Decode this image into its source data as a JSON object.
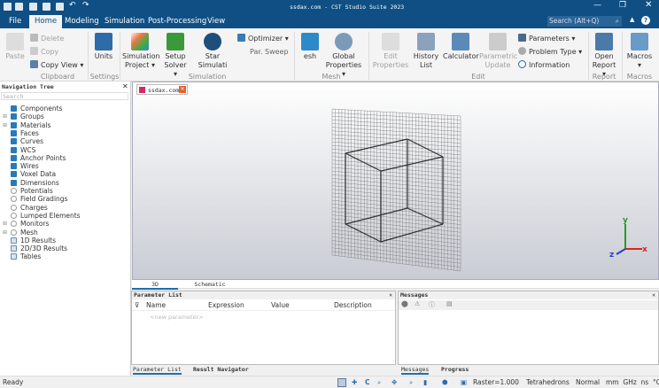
{
  "window": {
    "title": "ssdax.com - CST Studio Suite 2023",
    "search_placeholder": "Search (Alt+Q)"
  },
  "menu_tabs": [
    "File",
    "Home",
    "Modeling",
    "Simulation",
    "Post-Processing",
    "View"
  ],
  "ribbon": {
    "clipboard": {
      "paste": "Paste",
      "delete": "Delete",
      "copy": "Copy",
      "copy_view": "Copy View",
      "group": "Clipboard"
    },
    "settings": {
      "units": "Units",
      "group": "Settings"
    },
    "simulation": {
      "project_1": "Simulation",
      "project_2": "Project",
      "setup_1": "Setup",
      "setup_2": "Solver",
      "start_1": "Star",
      "start_2": "Simulati",
      "optimizer": "Optimizer",
      "par_sweep": "Par. Sweep",
      "group": "Simulation"
    },
    "mesh": {
      "mesh_label": "esh",
      "global_1": "Global",
      "global_2": "Properties",
      "group": "Mesh"
    },
    "edit": {
      "edit_props_1": "Edit",
      "edit_props_2": "Properties",
      "history_1": "History",
      "history_2": "List",
      "calculator": "Calculator",
      "param_update_1": "Parametric",
      "param_update_2": "Update",
      "parameters": "Parameters",
      "problem_type": "Problem Type",
      "information": "Information",
      "group": "Edit"
    },
    "report": {
      "open_1": "Open",
      "open_2": "Report",
      "group": "Report"
    },
    "macros": {
      "macros": "Macros",
      "group": "Macros"
    }
  },
  "nav": {
    "title": "Navigation Tree",
    "search_placeholder": "Search",
    "items": [
      "Components",
      "Groups",
      "Materials",
      "Faces",
      "Curves",
      "WCS",
      "Anchor Points",
      "Wires",
      "Voxel Data",
      "Dimensions",
      "Potentials",
      "Field Gradings",
      "Charges",
      "Lumped Elements",
      "Monitors",
      "Mesh",
      "1D Results",
      "2D/3D Results",
      "Tables"
    ]
  },
  "doc_tab": "ssdax.com",
  "view_tabs": [
    "3D",
    "Schematic"
  ],
  "axes": {
    "x": "x",
    "y": "y",
    "z": "z"
  },
  "param_list": {
    "title": "Parameter List",
    "columns": [
      "Name",
      "Expression",
      "Value",
      "Description"
    ],
    "new_row": "<new parameter>",
    "tabs": [
      "Parameter List",
      "Result Navigator"
    ]
  },
  "messages": {
    "title": "Messages",
    "tabs": [
      "Messages",
      "Progress"
    ]
  },
  "status": {
    "ready": "Ready",
    "raster": "Raster=1.000",
    "mesh_type": "Tetrahedrons",
    "mode": "Normal",
    "units": "mm  GHz  ns  °C"
  },
  "colors": {
    "title_bar": "#0f4f84",
    "accent": "#1e6fb0"
  }
}
